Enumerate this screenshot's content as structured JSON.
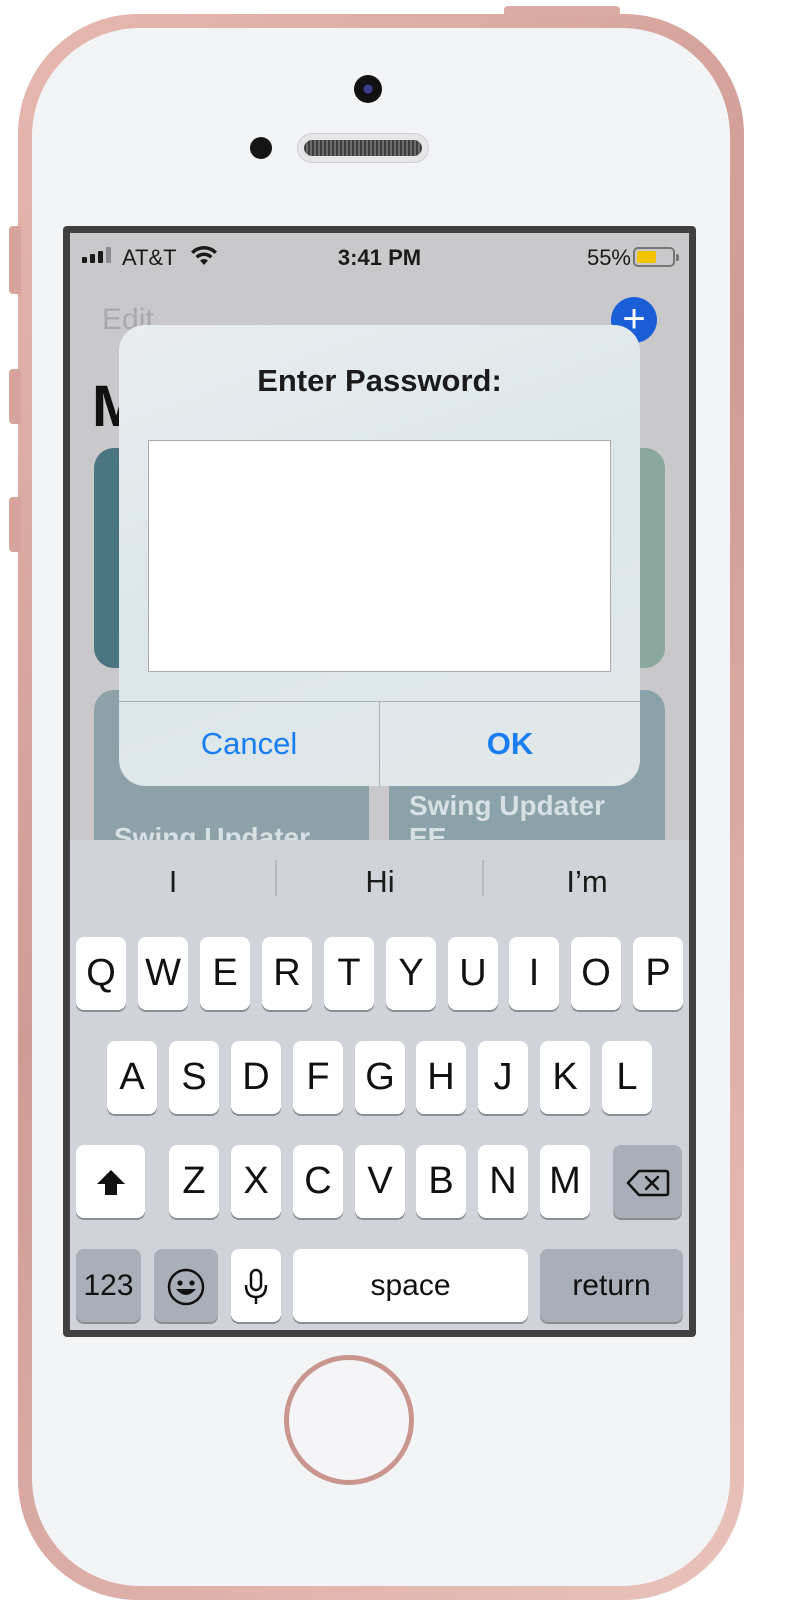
{
  "status_bar": {
    "carrier": "AT&T",
    "time": "3:41 PM",
    "battery_percent": "55%",
    "battery_level": 0.55,
    "battery_color": "#f2c300"
  },
  "background_app": {
    "edit_label": "Edit",
    "add_icon": "plus-icon",
    "title_partial": "M",
    "cards": [
      {
        "title": "Swing Updater"
      },
      {
        "title": "Swing Updater EE"
      }
    ]
  },
  "alert": {
    "title": "Enter Password:",
    "input_value": "",
    "cancel_label": "Cancel",
    "ok_label": "OK",
    "accent_color": "#1a7ef0"
  },
  "keyboard": {
    "suggestions": [
      "I",
      "Hi",
      "I’m"
    ],
    "row1": [
      "Q",
      "W",
      "E",
      "R",
      "T",
      "Y",
      "U",
      "I",
      "O",
      "P"
    ],
    "row2": [
      "A",
      "S",
      "D",
      "F",
      "G",
      "H",
      "J",
      "K",
      "L"
    ],
    "row3": [
      "Z",
      "X",
      "C",
      "V",
      "B",
      "N",
      "M"
    ],
    "numbers_label": "123",
    "space_label": "space",
    "return_label": "return",
    "shift_icon": "shift-arrow-icon",
    "delete_icon": "backspace-icon",
    "emoji_icon": "emoji-icon",
    "mic_icon": "microphone-icon"
  }
}
